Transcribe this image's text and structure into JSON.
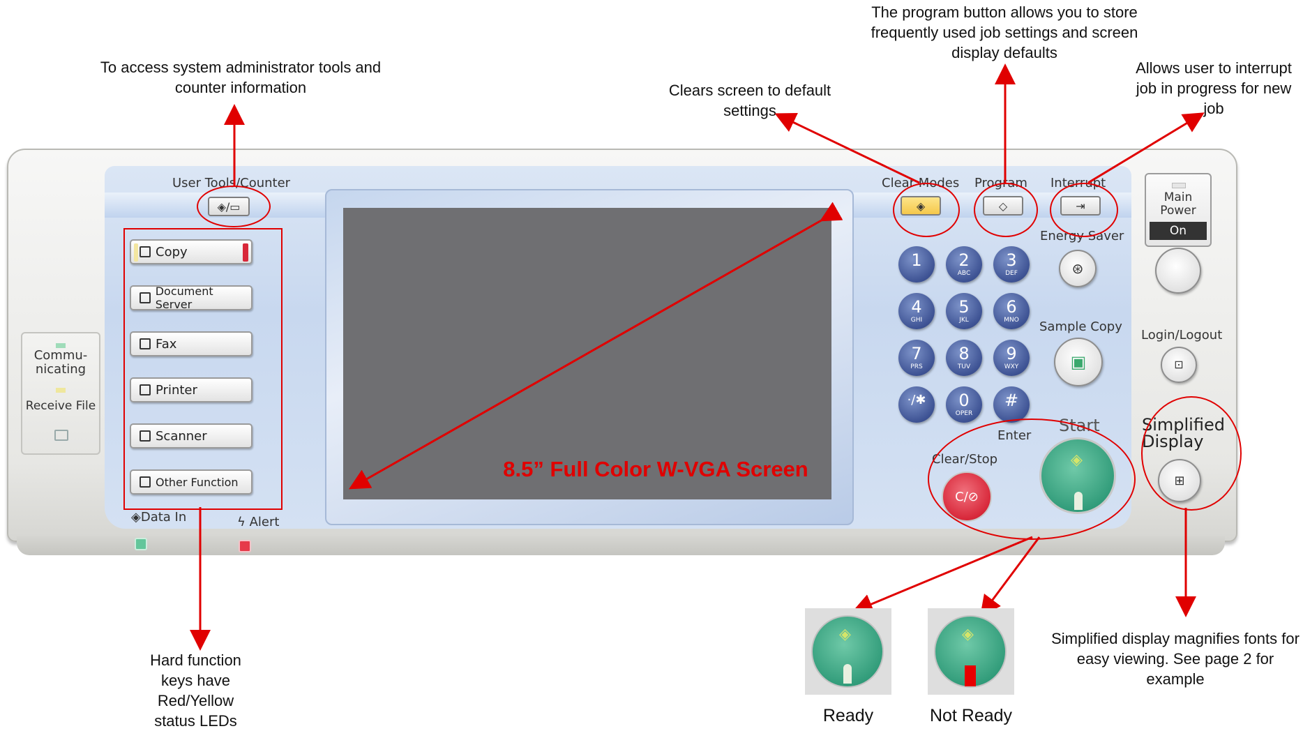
{
  "annotations": {
    "user_tools": "To access system administrator tools and counter information",
    "clear_modes": "Clears screen to default settings",
    "program": "The program button allows you to store frequently used job settings and screen display defaults",
    "interrupt": "Allows user to interrupt job in progress for new job",
    "function_keys": "Hard function keys have Red/Yellow status LEDs",
    "simplified_display": "Simplified display magnifies fonts for easy viewing. See page 2 for example"
  },
  "screen": {
    "caption": "8.5” Full Color W-VGA Screen"
  },
  "left_status": {
    "communicating": "Commu-\nnicating",
    "receive_file": "Receive File"
  },
  "panel_labels": {
    "user_tools_counter": "User Tools/Counter",
    "clear_modes": "Clear Modes",
    "program": "Program",
    "interrupt": "Interrupt",
    "main_power": "Main\nPower",
    "on": "On",
    "energy_saver": "Energy Saver",
    "sample_copy": "Sample Copy",
    "login_logout": "Login/Logout",
    "simplified_display": "Simplified\nDisplay",
    "enter": "Enter",
    "start": "Start",
    "clear_stop": "Clear/Stop",
    "data_in": "Data In",
    "alert": "Alert"
  },
  "function_keys": [
    {
      "label": "Copy",
      "led": "#d8283a"
    },
    {
      "label": "Document Server",
      "led": ""
    },
    {
      "label": "Fax",
      "led": ""
    },
    {
      "label": "Printer",
      "led": ""
    },
    {
      "label": "Scanner",
      "led": ""
    },
    {
      "label": "Other Function",
      "led": ""
    }
  ],
  "keypad": [
    {
      "digit": "1",
      "letters": ""
    },
    {
      "digit": "2",
      "letters": "ABC"
    },
    {
      "digit": "3",
      "letters": "DEF"
    },
    {
      "digit": "4",
      "letters": "GHI"
    },
    {
      "digit": "5",
      "letters": "JKL"
    },
    {
      "digit": "6",
      "letters": "MNO"
    },
    {
      "digit": "7",
      "letters": "PRS"
    },
    {
      "digit": "8",
      "letters": "TUV"
    },
    {
      "digit": "9",
      "letters": "WXY"
    },
    {
      "digit": "·/✱",
      "letters": ""
    },
    {
      "digit": "0",
      "letters": "OPER"
    },
    {
      "digit": "#",
      "letters": ""
    }
  ],
  "status_examples": {
    "ready": "Ready",
    "not_ready": "Not Ready"
  },
  "colors": {
    "annotation_red": "#e00000",
    "start_green": "#2f9a78",
    "keypad_blue": "#3e5394",
    "clear_stop_red": "#d8283a",
    "clear_modes_yellow": "#f5c84a"
  }
}
